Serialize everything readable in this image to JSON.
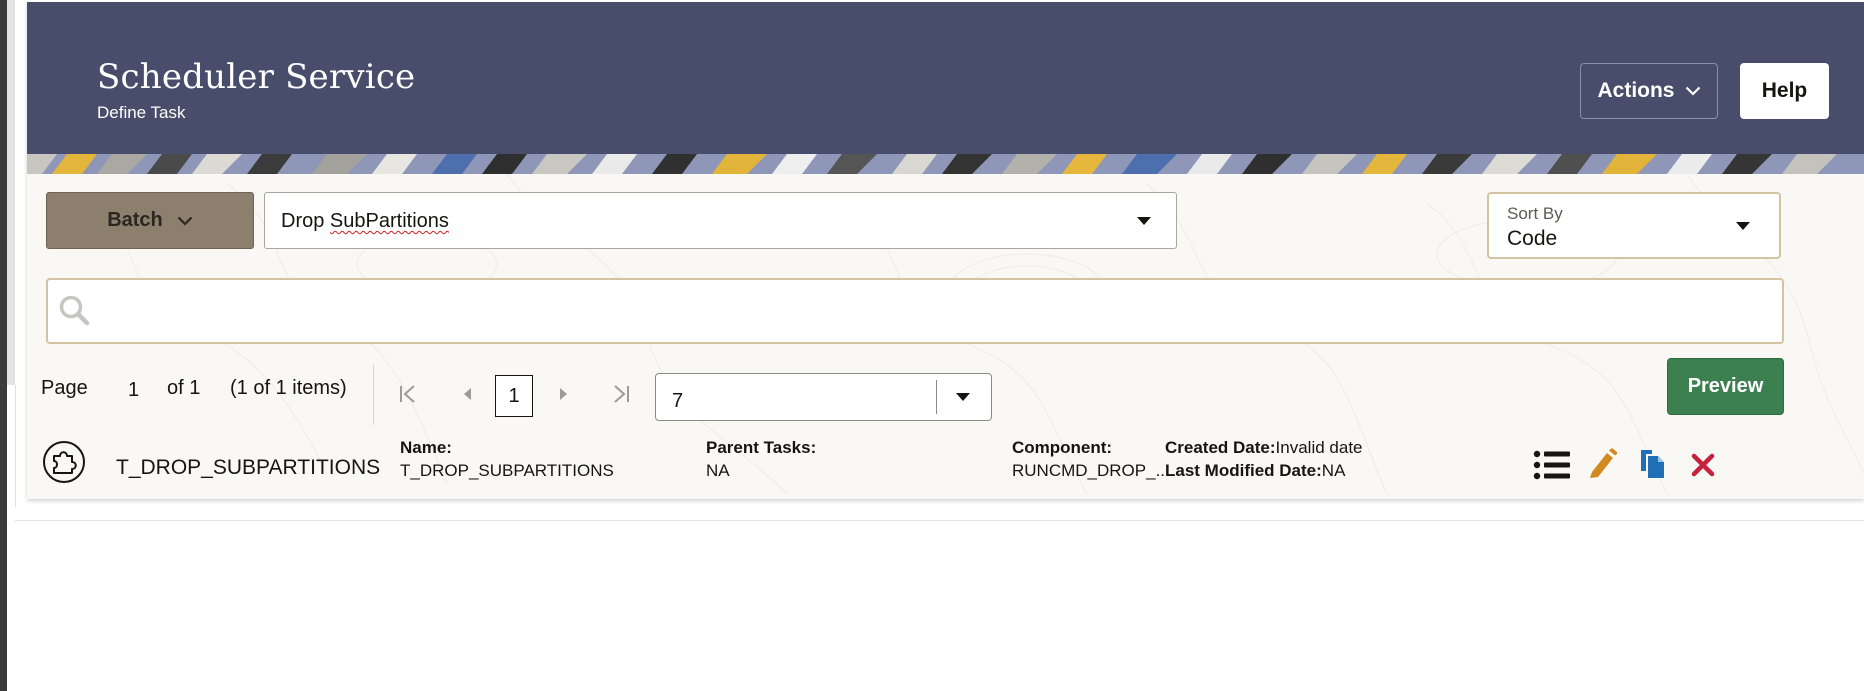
{
  "header": {
    "title": "Scheduler Service",
    "subtitle": "Define Task",
    "actions_label": "Actions",
    "help_label": "Help",
    "background_color": "#474d6b"
  },
  "toolbar": {
    "batch_label": "Batch",
    "selected_batch": "Drop SubPartitions",
    "sort_by_label": "Sort By",
    "sort_by_value": "Code"
  },
  "search": {
    "placeholder": ""
  },
  "pagination": {
    "page_label": "Page",
    "current_page": "1",
    "of_label": "of 1",
    "items_summary": "(1 of 1 items)",
    "page_input_value": "1",
    "page_size_value": "7",
    "preview_label": "Preview"
  },
  "tasks": [
    {
      "code": "T_DROP_SUBPARTITIONS",
      "name_label": "Name:",
      "name_value": "T_DROP_SUBPARTITIONS",
      "parent_label": "Parent Tasks:",
      "parent_value": "NA",
      "component_label": "Component:",
      "component_value": "RUNCMD_DROP_...",
      "created_label": "Created Date:",
      "created_value": "Invalid date",
      "modified_label": "Last Modified Date:",
      "modified_value": "NA"
    }
  ],
  "icons": {
    "row": "puzzle-icon",
    "actions": [
      "list-icon",
      "edit-pencil-icon",
      "copy-icon",
      "delete-icon"
    ]
  },
  "colors": {
    "batch_button": "#8c7f6e",
    "preview_button": "#3d8050",
    "edit_icon": "#d08a1e",
    "copy_icon": "#1e6fb5",
    "delete_icon": "#c7213e",
    "input_border": "#d4c3a2"
  }
}
